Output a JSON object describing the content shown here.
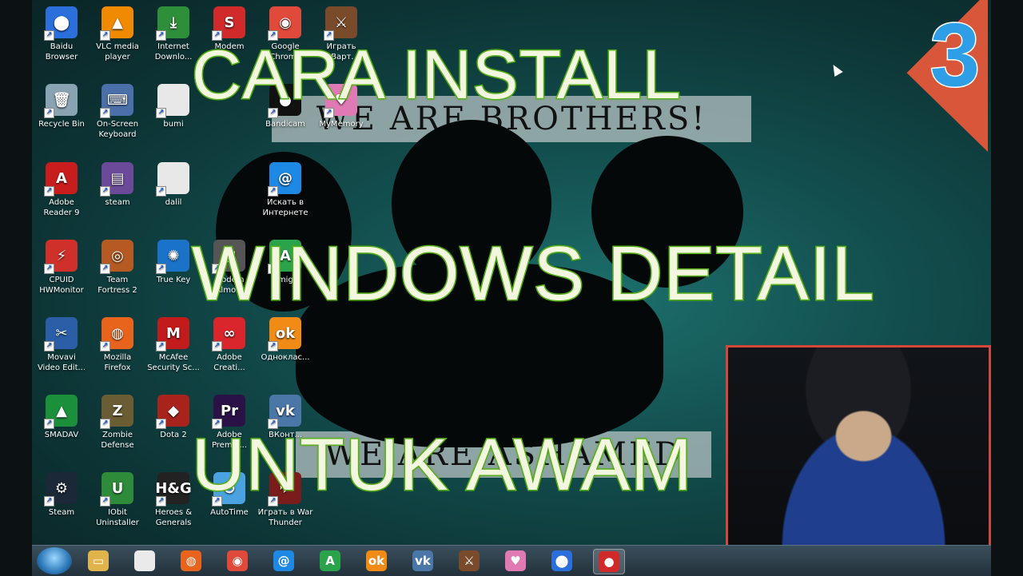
{
  "desktop_icons": [
    {
      "label": "Baidu\nBrowser",
      "name": "desktop-icon-baidu-browser",
      "icon": "baidu-icon",
      "color": "#2a6fdb",
      "glyph": "⬤"
    },
    {
      "label": "VLC media\nplayer",
      "name": "desktop-icon-vlc",
      "icon": "vlc-cone-icon",
      "color": "#f08a00",
      "glyph": "▲"
    },
    {
      "label": "Internet\nDownlo...",
      "name": "desktop-icon-idm",
      "icon": "globe-download-icon",
      "color": "#2e8f3a",
      "glyph": "⤓"
    },
    {
      "label": "Modem",
      "name": "desktop-icon-modem",
      "icon": "modem-icon",
      "color": "#d02a2a",
      "glyph": "S"
    },
    {
      "label": "Google\nChrome",
      "name": "desktop-icon-chrome",
      "icon": "chrome-icon",
      "color": "#e04a3a",
      "glyph": "◉"
    },
    {
      "label": "Играть\nв Варт...",
      "name": "desktop-icon-game-top",
      "icon": "game-portrait-icon",
      "color": "#7a4b2a",
      "glyph": "⚔"
    },
    {
      "label": "Recycle Bin",
      "name": "desktop-icon-recycle-bin",
      "icon": "recycle-bin-icon",
      "color": "#8aa3b3",
      "glyph": "🗑"
    },
    {
      "label": "On-Screen\nKeyboard",
      "name": "desktop-icon-onscreen-keyboard",
      "icon": "keyboard-icon",
      "color": "#4b6fa8",
      "glyph": "⌨"
    },
    {
      "label": "bumi",
      "name": "desktop-icon-bumi",
      "icon": "blank-file-icon",
      "color": "#e8e8e8",
      "glyph": ""
    },
    {
      "label": "Bandicam",
      "name": "desktop-icon-bandicam",
      "icon": "bandicam-icon",
      "color": "#111",
      "glyph": "●"
    },
    {
      "label": "MyMemory",
      "name": "desktop-icon-mymemory",
      "icon": "mymemory-icon",
      "color": "#e07ab4",
      "glyph": "♥"
    },
    {
      "label": "Adobe\nReader 9",
      "name": "desktop-icon-adobe-reader",
      "icon": "adobe-reader-icon",
      "color": "#c81d1d",
      "glyph": "A"
    },
    {
      "label": "steam",
      "name": "desktop-icon-steam-archive",
      "icon": "winrar-icon",
      "color": "#6b4a9a",
      "glyph": "▤"
    },
    {
      "label": "dalil",
      "name": "desktop-icon-dalil",
      "icon": "blank-file-icon",
      "color": "#e8e8e8",
      "glyph": ""
    },
    {
      "label": "Искать в\nИнтернете",
      "name": "desktop-icon-search-internet",
      "icon": "mail-at-icon",
      "color": "#1e88e5",
      "glyph": "@"
    },
    {
      "label": "CPUID\nHWMonitor",
      "name": "desktop-icon-hwmonitor",
      "icon": "hwmonitor-icon",
      "color": "#d0302a",
      "glyph": "⚡"
    },
    {
      "label": "Team\nFortress 2",
      "name": "desktop-icon-tf2",
      "icon": "tf2-icon",
      "color": "#b55a22",
      "glyph": "◎"
    },
    {
      "label": "True Key",
      "name": "desktop-icon-true-key",
      "icon": "true-key-icon",
      "color": "#1a73c9",
      "glyph": "✺"
    },
    {
      "label": "Modem\nAlmo...",
      "name": "desktop-icon-modem-almo",
      "icon": "modem-icon",
      "color": "#555",
      "glyph": "▦"
    },
    {
      "label": "Amigo",
      "name": "desktop-icon-amigo",
      "icon": "amigo-icon",
      "color": "#2aa34a",
      "glyph": "A"
    },
    {
      "label": "Movavi\nVideo Edit...",
      "name": "desktop-icon-movavi",
      "icon": "movavi-icon",
      "color": "#2a5fa8",
      "glyph": "✂"
    },
    {
      "label": "Mozilla\nFirefox",
      "name": "desktop-icon-firefox",
      "icon": "firefox-icon",
      "color": "#e8641c",
      "glyph": "◍"
    },
    {
      "label": "McAfee\nSecurity Sc...",
      "name": "desktop-icon-mcafee",
      "icon": "mcafee-icon",
      "color": "#c21b1b",
      "glyph": "M"
    },
    {
      "label": "Adobe\nCreati...",
      "name": "desktop-icon-adobe-cc",
      "icon": "adobe-cc-icon",
      "color": "#d9262c",
      "glyph": "∞"
    },
    {
      "label": "Одноклас...",
      "name": "desktop-icon-odnoklassniki",
      "icon": "odnoklassniki-icon",
      "color": "#f28a16",
      "glyph": "ok"
    },
    {
      "label": "SMADAV",
      "name": "desktop-icon-smadav",
      "icon": "smadav-icon",
      "color": "#1b8f3a",
      "glyph": "▲"
    },
    {
      "label": "Zombie\nDefense",
      "name": "desktop-icon-zombie-defense",
      "icon": "zombie-defense-icon",
      "color": "#6b5d33",
      "glyph": "Z"
    },
    {
      "label": "Dota 2",
      "name": "desktop-icon-dota2",
      "icon": "dota2-icon",
      "color": "#a8231c",
      "glyph": "◆"
    },
    {
      "label": "Adobe\nPremie...",
      "name": "desktop-icon-premiere",
      "icon": "premiere-icon",
      "color": "#2a1247",
      "glyph": "Pr"
    },
    {
      "label": "ВКонт...",
      "name": "desktop-icon-vk",
      "icon": "vk-icon",
      "color": "#4a76a8",
      "glyph": "vk"
    },
    {
      "label": "Steam",
      "name": "desktop-icon-steam",
      "icon": "steam-icon",
      "color": "#1b2838",
      "glyph": "⚙"
    },
    {
      "label": "IObit\nUninstaller",
      "name": "desktop-icon-iobit",
      "icon": "iobit-icon",
      "color": "#2e8b3a",
      "glyph": "U"
    },
    {
      "label": "Heroes &\nGenerals",
      "name": "desktop-icon-heroes-generals",
      "icon": "heroes-generals-icon",
      "color": "#222",
      "glyph": "H&G"
    },
    {
      "label": "AutoTime",
      "name": "desktop-icon-autotime",
      "icon": "autotime-icon",
      "color": "#4aa3e0",
      "glyph": "⏱"
    },
    {
      "label": "Играть в War\nThunder",
      "name": "desktop-icon-war-thunder",
      "icon": "war-thunder-icon",
      "color": "#7a1c1c",
      "glyph": "✈"
    }
  ],
  "wallpaper": {
    "top_text": "WE ARE BROTHERS!",
    "bottom_text": "WE ARE ASHAMED"
  },
  "overlay": {
    "line1": "CARA INSTALL",
    "line2": "WINDOWS  DETAIL",
    "line3": "UNTUK  AWAM",
    "episode": "3"
  },
  "taskbar": {
    "items": [
      {
        "name": "taskbar-explorer",
        "icon": "folder-icon",
        "color": "#e0b44a",
        "glyph": "▭"
      },
      {
        "name": "taskbar-file",
        "icon": "blank-file-icon",
        "color": "#eaeaea",
        "glyph": ""
      },
      {
        "name": "taskbar-firefox",
        "icon": "firefox-icon",
        "color": "#e8641c",
        "glyph": "◍"
      },
      {
        "name": "taskbar-chrome",
        "icon": "chrome-icon",
        "color": "#e04a3a",
        "glyph": "◉"
      },
      {
        "name": "taskbar-mail-search",
        "icon": "mail-at-icon",
        "color": "#1e88e5",
        "glyph": "@"
      },
      {
        "name": "taskbar-amigo",
        "icon": "amigo-icon",
        "color": "#2aa34a",
        "glyph": "A"
      },
      {
        "name": "taskbar-odnoklassniki",
        "icon": "odnoklassniki-icon",
        "color": "#f28a16",
        "glyph": "ok"
      },
      {
        "name": "taskbar-vk",
        "icon": "vk-icon",
        "color": "#4a76a8",
        "glyph": "vk"
      },
      {
        "name": "taskbar-game",
        "icon": "game-portrait-icon",
        "color": "#7a4b2a",
        "glyph": "⚔"
      },
      {
        "name": "taskbar-mymemory",
        "icon": "mymemory-icon",
        "color": "#e07ab4",
        "glyph": "♥"
      },
      {
        "name": "taskbar-baidu",
        "icon": "baidu-icon",
        "color": "#2a6fdb",
        "glyph": "⬤"
      },
      {
        "name": "taskbar-bandicam",
        "icon": "bandicam-icon",
        "color": "#d02a2a",
        "glyph": "●",
        "active": true
      }
    ]
  },
  "colors": {
    "overlay_stroke": "#5bc21a",
    "overlay_fill": "#f4f7df",
    "episode_blue": "#2e9ee6",
    "corner_red": "#d8573a",
    "webcam_border": "#d8463a"
  }
}
